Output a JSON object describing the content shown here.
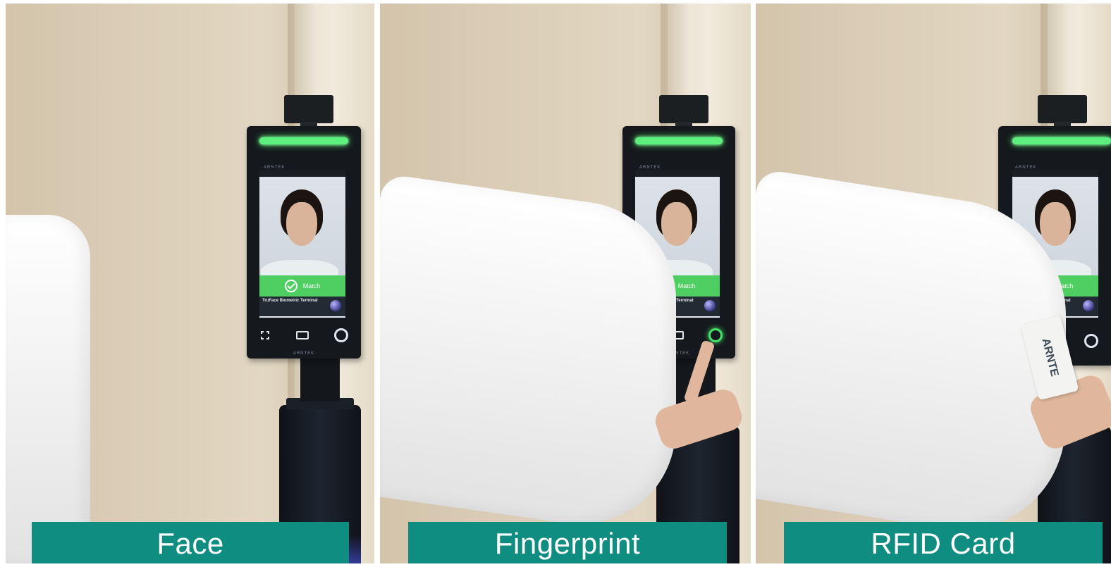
{
  "captions": {
    "face": "Face",
    "fingerprint": "Fingerprint",
    "rfid": "RFID Card"
  },
  "device": {
    "brand": "ARNTEK",
    "match_text": "Match",
    "info_title": "TruFace Biometric Terminal"
  },
  "card": {
    "brand": "ARNTE"
  },
  "colors": {
    "caption_bg": "#108d81",
    "light_bar": "#5ef07e",
    "match_green": "#4fcf62"
  },
  "active_method": {
    "face_panel": "face",
    "fingerprint_panel": "fingerprint",
    "rfid_panel": "rfid"
  }
}
